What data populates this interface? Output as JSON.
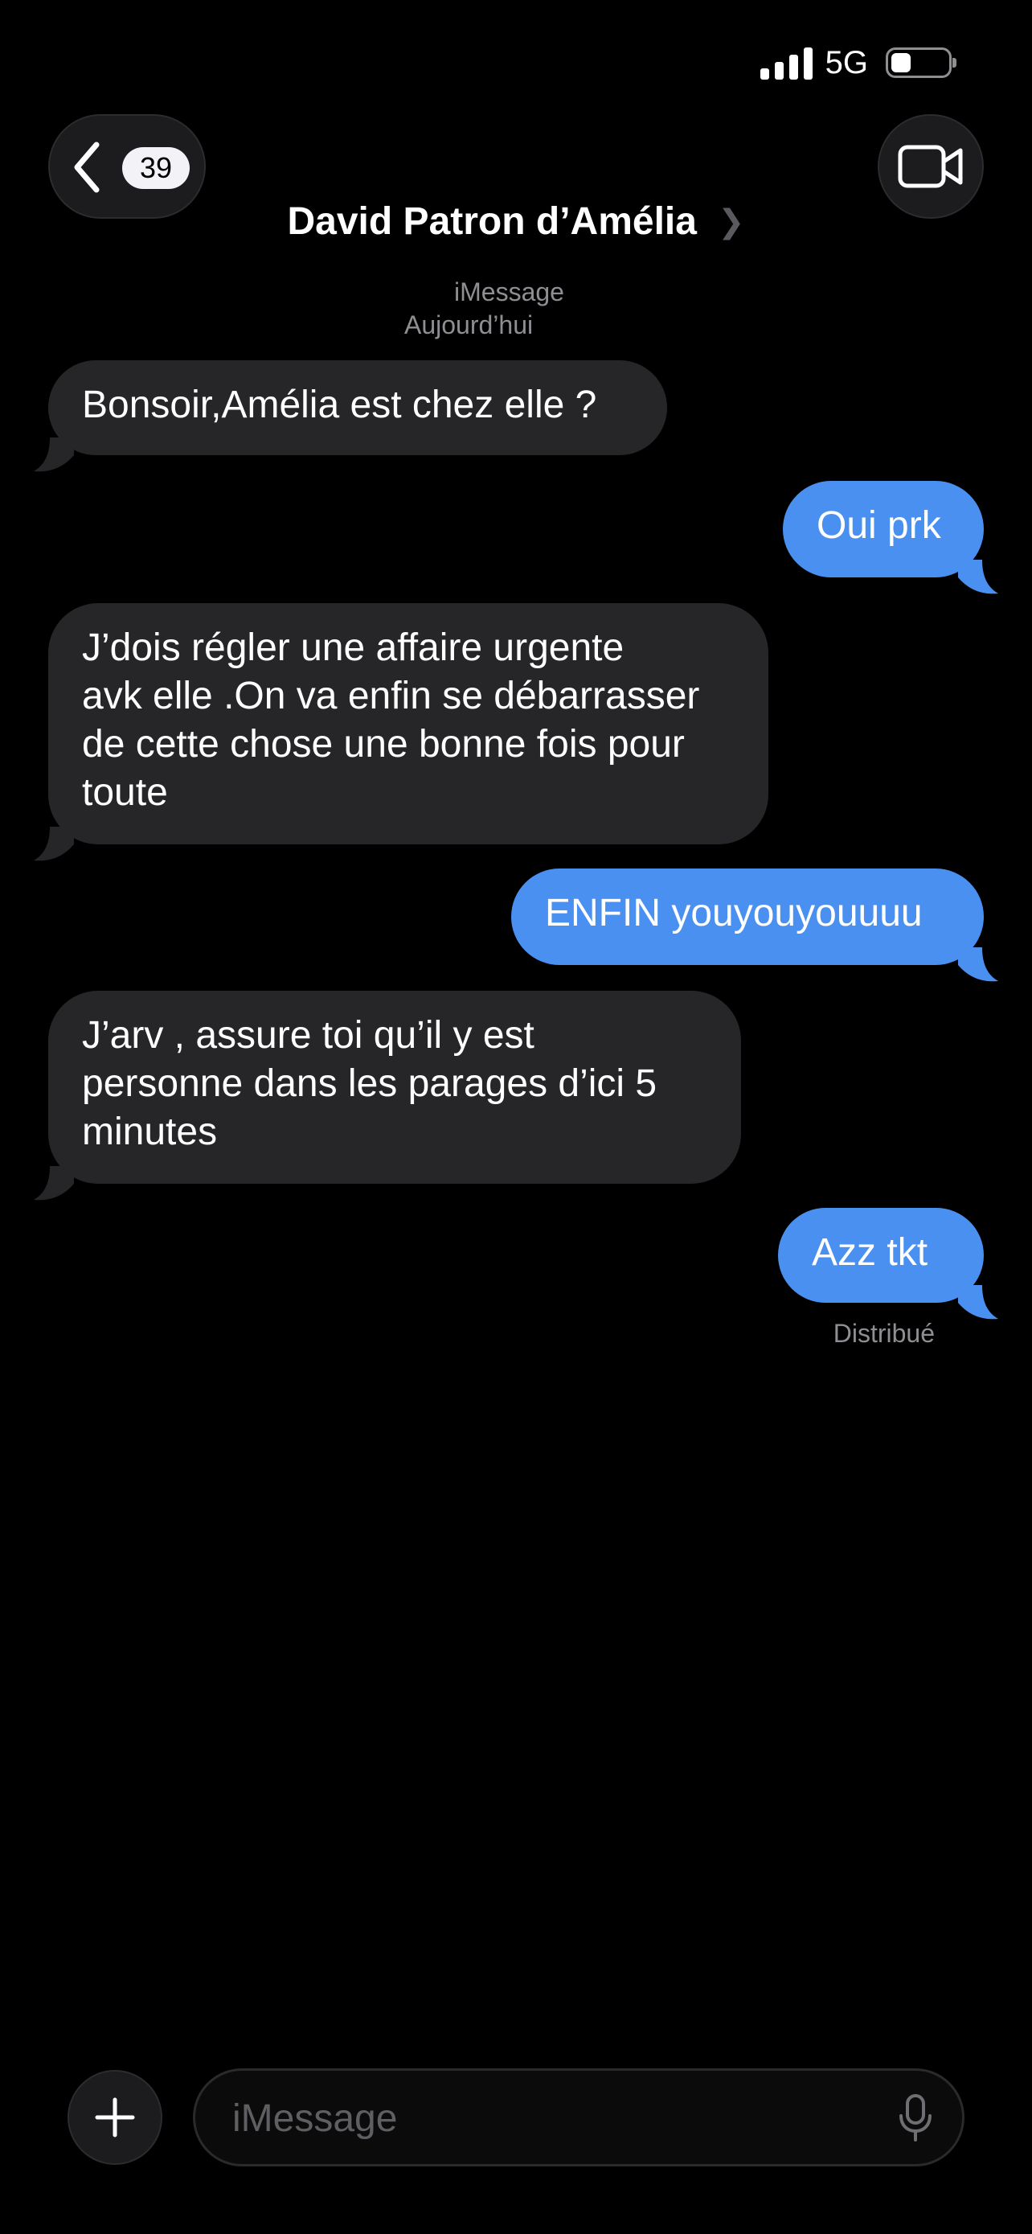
{
  "status_bar": {
    "network": "5G",
    "signal_bars": 4,
    "battery_level": 0.35
  },
  "header": {
    "unread_count": "39",
    "contact_name": "David Patron d’Amélia",
    "chevron": "❯",
    "service": "iMessage",
    "date": "Aujourd’hui"
  },
  "messages": [
    {
      "direction": "received",
      "text": "Bonsoir,Amélia est chez elle ?"
    },
    {
      "direction": "sent",
      "text": "Oui prk"
    },
    {
      "direction": "received",
      "text": "J’dois régler une affaire urgente\navk elle .On va enfin se débarrasser\nde cette chose une bonne fois pour\ntoute"
    },
    {
      "direction": "sent",
      "text": "ENFIN youyouyouuuu"
    },
    {
      "direction": "received",
      "text": "J’arv , assure toi qu’il y est\npersonne dans les parages d’ici 5\nminutes"
    },
    {
      "direction": "sent",
      "text": "Azz tkt"
    }
  ],
  "delivery_status": "Distribué",
  "composer": {
    "placeholder": "iMessage"
  },
  "icons": {
    "back": "chevron-left-icon",
    "video": "video-camera-icon",
    "plus": "plus-icon",
    "mic": "microphone-icon"
  },
  "colors": {
    "background": "#000000",
    "sent_bubble": "#4a90f0",
    "received_bubble": "#262628",
    "secondary_text": "#8e8e93"
  }
}
